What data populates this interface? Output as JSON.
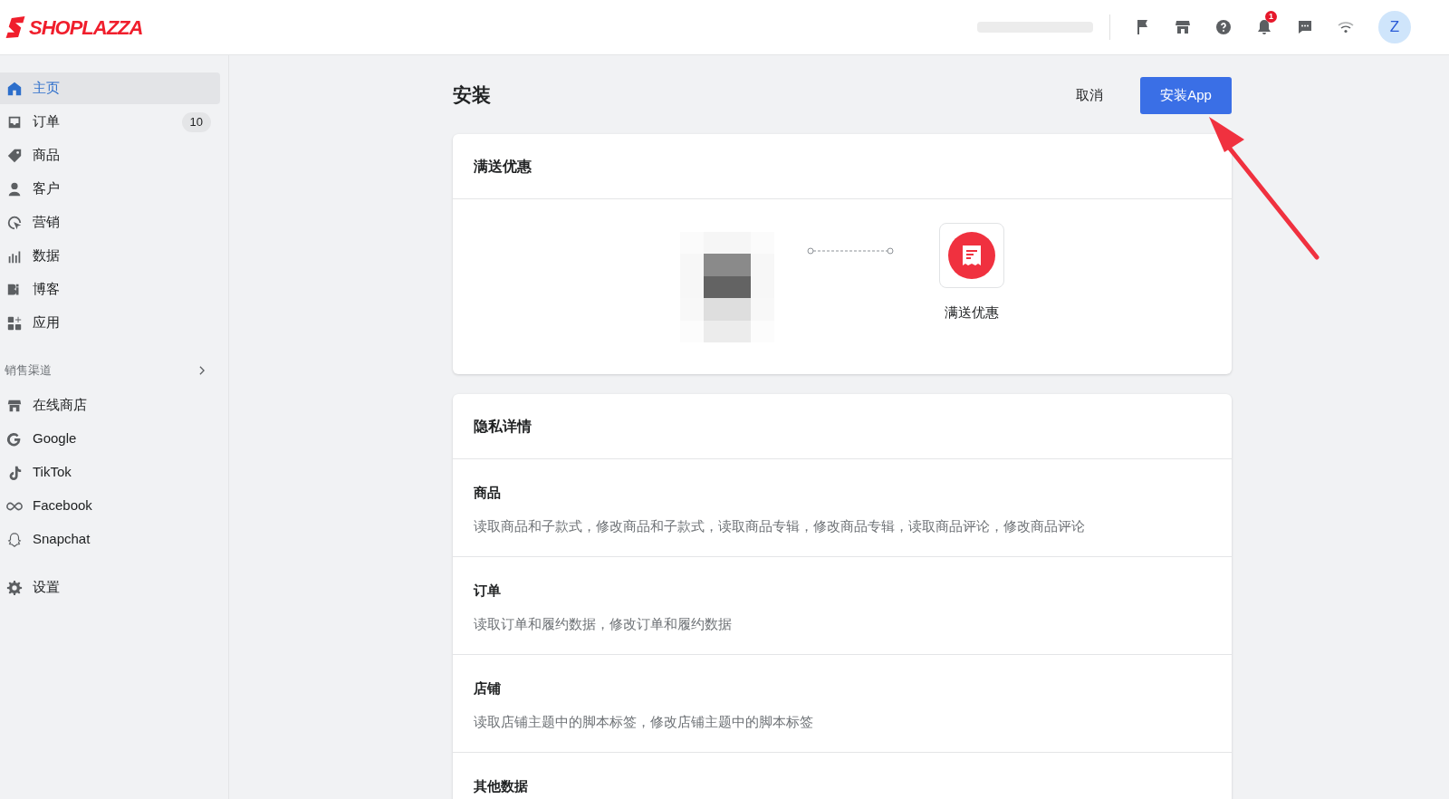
{
  "header": {
    "logo": "SHOPLAZZA",
    "notification_count": "1",
    "avatar_initial": "Z"
  },
  "sidebar": {
    "items": [
      {
        "label": "主页",
        "selected": true
      },
      {
        "label": "订单",
        "selected": false,
        "badge": "10"
      },
      {
        "label": "商品",
        "selected": false
      },
      {
        "label": "客户",
        "selected": false
      },
      {
        "label": "营销",
        "selected": false
      },
      {
        "label": "数据",
        "selected": false
      },
      {
        "label": "博客",
        "selected": false
      },
      {
        "label": "应用",
        "selected": false
      }
    ],
    "section_title": "销售渠道",
    "channels": [
      {
        "label": "在线商店",
        "selected": false
      },
      {
        "label": "Google",
        "selected": false
      },
      {
        "label": "TikTok",
        "selected": false
      },
      {
        "label": "Facebook",
        "selected": false
      },
      {
        "label": "Snapchat",
        "selected": false
      }
    ],
    "settings": {
      "label": "设置",
      "selected": false
    }
  },
  "page": {
    "title": "安装",
    "cancel_button": "取消",
    "install_button": "安装App"
  },
  "app_card": {
    "title": "满送优惠",
    "app_name": "满送优惠"
  },
  "privacy_card": {
    "title": "隐私详情",
    "sections": [
      {
        "title": "商品",
        "description": "读取商品和子款式，修改商品和子款式，读取商品专辑，修改商品专辑，读取商品评论，修改商品评论"
      },
      {
        "title": "订单",
        "description": "读取订单和履约数据，修改订单和履约数据"
      },
      {
        "title": "店铺",
        "description": "读取店铺主题中的脚本标签，修改店铺主题中的脚本标签"
      },
      {
        "title": "其他数据"
      }
    ]
  }
}
